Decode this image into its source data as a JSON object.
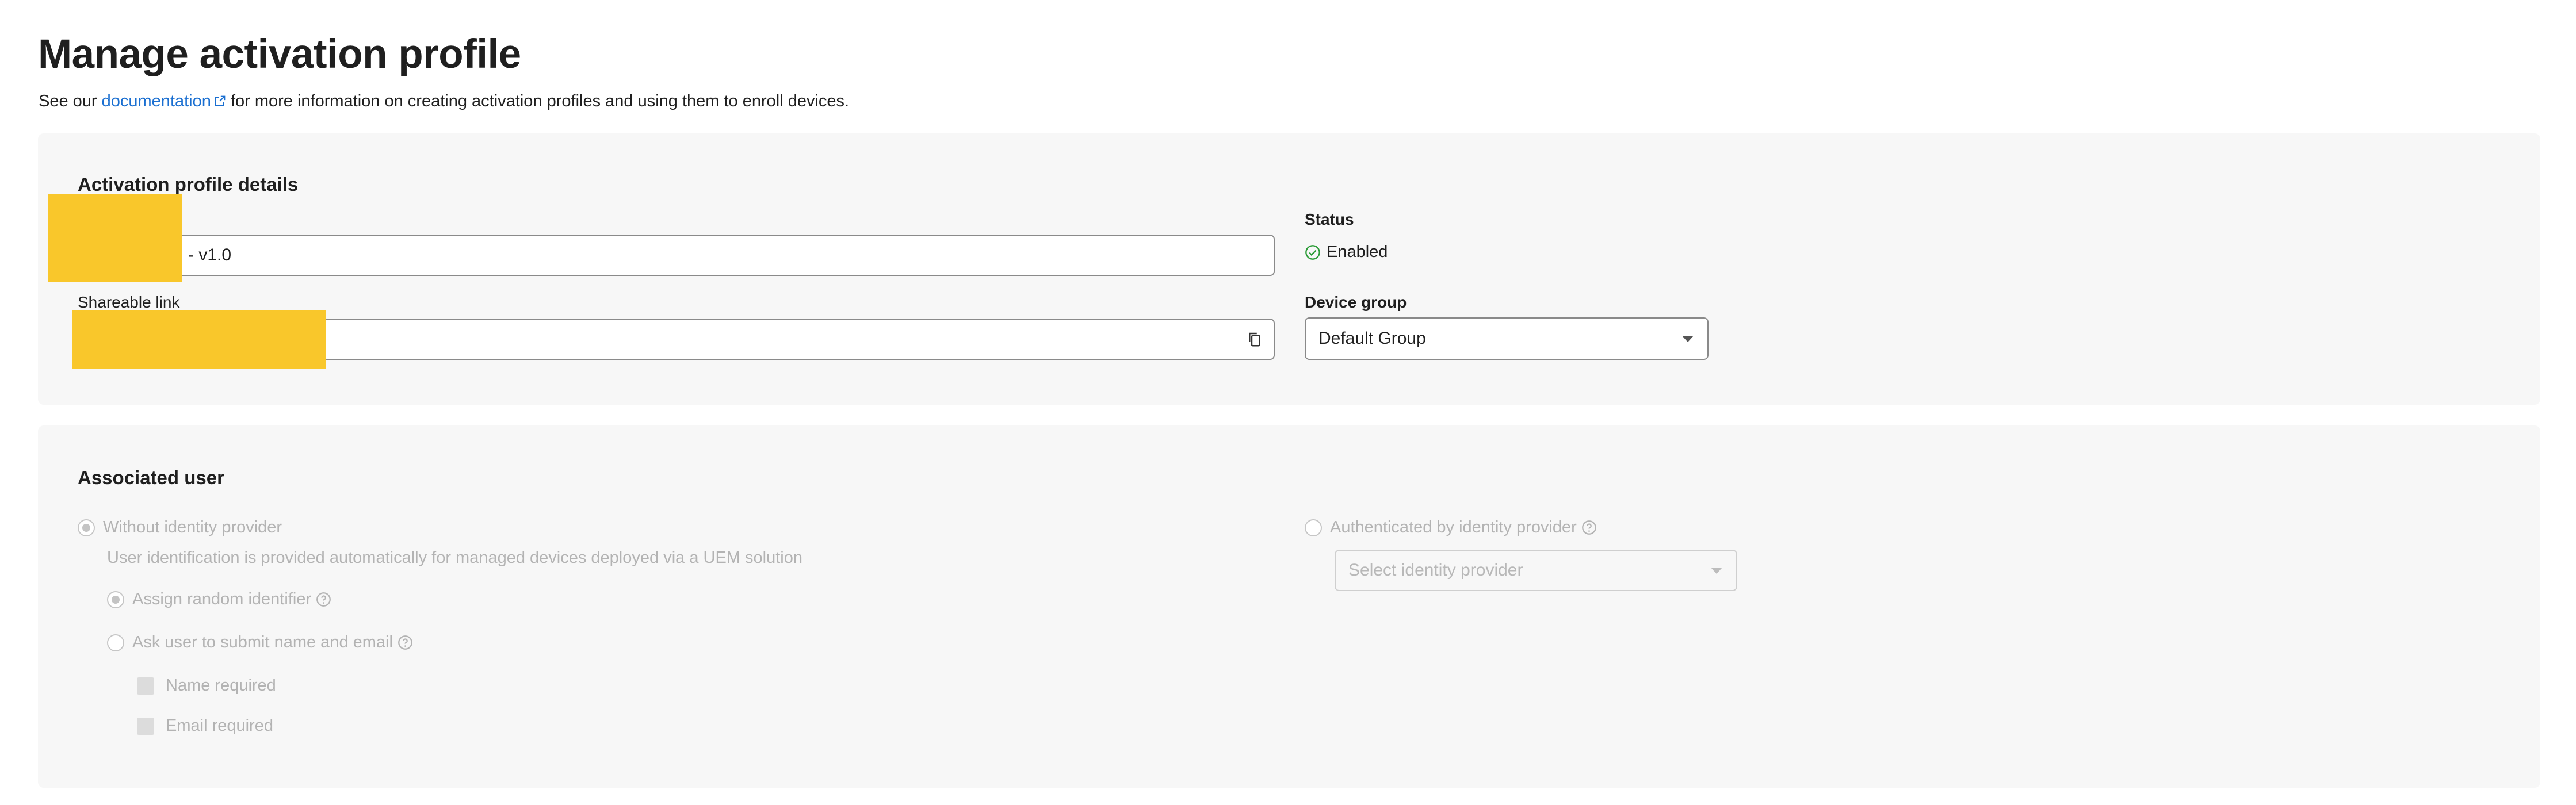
{
  "page": {
    "title": "Manage activation profile",
    "intro_prefix": "See our ",
    "intro_link": "documentation",
    "intro_suffix": " for more information on creating activation profiles and using them to enroll devices."
  },
  "details": {
    "section_title": "Activation profile details",
    "profile_name_value": "- v1.0",
    "shareable_link_label": "Shareable link",
    "status_label": "Status",
    "status_value": "Enabled",
    "device_group_label": "Device group",
    "device_group_value": "Default Group"
  },
  "associated_user": {
    "section_title": "Associated user",
    "without_idp_label": "Without identity provider",
    "without_idp_hint": "User identification is provided automatically for managed devices deployed via a UEM solution",
    "assign_random_label": "Assign random identifier",
    "ask_user_label": "Ask user to submit name and email",
    "name_required_label": "Name required",
    "email_required_label": "Email required",
    "auth_idp_label": "Authenticated by identity provider",
    "idp_select_placeholder": "Select identity provider"
  },
  "colors": {
    "link": "#1a6fd1",
    "status_enabled": "#2e9d3a",
    "redaction": "#f9c72b"
  }
}
